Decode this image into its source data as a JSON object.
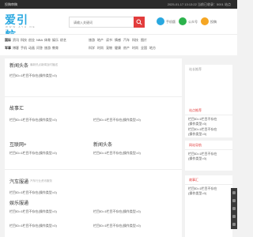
{
  "topbar": {
    "left": "投稿审稿",
    "right": "2025-01-17 13:13:22    当前已收录：5001 站点"
  },
  "header": {
    "logo": "爱引航",
    "logo_sub": "W W W . A Y H . N E T",
    "search_placeholder": "请输入关键词",
    "icons": [
      {
        "name": "手机版",
        "icon": "phone-icon",
        "color": "#29a8e0"
      },
      {
        "name": "公众号",
        "icon": "wechat-icon",
        "color": "#2bb24c"
      },
      {
        "name": "投稿",
        "icon": "submit-icon",
        "color": "#f5a623"
      }
    ]
  },
  "nav": [
    {
      "label": "国际",
      "hl": false
    },
    {
      "label": "资讯",
      "hl": false
    },
    {
      "label": "科技",
      "hl": false
    },
    {
      "label": "创业",
      "hl": false
    },
    {
      "label": "NBA",
      "hl": false
    },
    {
      "label": "体育",
      "hl": false
    },
    {
      "label": "娱乐",
      "hl": false
    },
    {
      "label": "综艺",
      "hl": false
    },
    {
      "label": "军事",
      "hl": false
    },
    {
      "label": "博客",
      "hl": false
    },
    {
      "label": "手机",
      "hl": false
    },
    {
      "label": "动画",
      "hl": false
    },
    {
      "label": "问答",
      "hl": false
    },
    {
      "label": "旅游",
      "hl": false
    },
    {
      "label": "教育",
      "hl": false
    },
    {
      "label": "旅游",
      "hl": false
    },
    {
      "label": "地产",
      "hl": false
    },
    {
      "label": "读书",
      "hl": false
    },
    {
      "label": "情感",
      "hl": false
    },
    {
      "label": "汽车",
      "hl": false
    },
    {
      "label": "科技",
      "hl": false
    },
    {
      "label": "图片",
      "hl": false
    },
    {
      "label": "科学",
      "hl": false
    },
    {
      "label": "时尚",
      "hl": false
    },
    {
      "label": "宠物",
      "hl": false
    },
    {
      "label": "健康",
      "hl": false
    },
    {
      "label": "房产",
      "hl": false
    },
    {
      "label": "时尚",
      "hl": false
    },
    {
      "label": "全国",
      "hl": false
    },
    {
      "label": "地方",
      "hl": false
    }
  ],
  "main": {
    "sections": [
      {
        "title": "新闻头条",
        "desc": "最新热点新闻及时播送",
        "items": [
          "栏目ID=1栏目不存在(操作类型=0)"
        ]
      },
      {
        "title": "故事汇",
        "desc": "",
        "items": [
          "栏目ID=1栏目不存在(操作类型=0)",
          "栏目ID=1栏目不存在(操作类型=0)",
          "栏目ID=1栏目不存在(操作类型=0)",
          "栏目ID=1栏目不存在(操作类型=0)"
        ]
      },
      {
        "title": "互联网+",
        "desc": "",
        "col2_title": "新闻头条",
        "items": [
          "栏目ID=1栏目不存在(操作类型=0)",
          "栏目ID=1栏目不存在(操作类型=0)"
        ]
      },
      {
        "title": "汽车服通",
        "desc": "汽车行业资讯服务",
        "items": [
          "栏目ID=1栏目不存在(操作类型=0)"
        ]
      },
      {
        "title": "娱乐服通",
        "desc": "",
        "items": [
          "栏目ID=1栏目不存在(操作类型=0)",
          "栏目ID=1栏目不存在(操作类型=0)",
          "栏目ID=1栏目不存在(操作类型=0)",
          "栏目ID=1栏目不存在(操作类型=0)"
        ]
      }
    ]
  },
  "side": {
    "cards": [
      {
        "title": "站长推荐",
        "lines": []
      },
      {
        "title": "站点推荐",
        "lines": [
          "栏目ID=1栏目不存在",
          "(操作类型=0)",
          "栏目ID=1栏目不存在",
          "(操作类型=0)"
        ]
      },
      {
        "title": "网站导航",
        "lines": [
          "栏目ID=1栏目不存在",
          "(操作类型=0)",
          "栏目ID=1栏目不存在(操作类型=0)"
        ]
      },
      {
        "title": "故事汇",
        "lines": [
          "栏目ID=1栏目不存在",
          "(操作类型=0)"
        ]
      }
    ]
  }
}
